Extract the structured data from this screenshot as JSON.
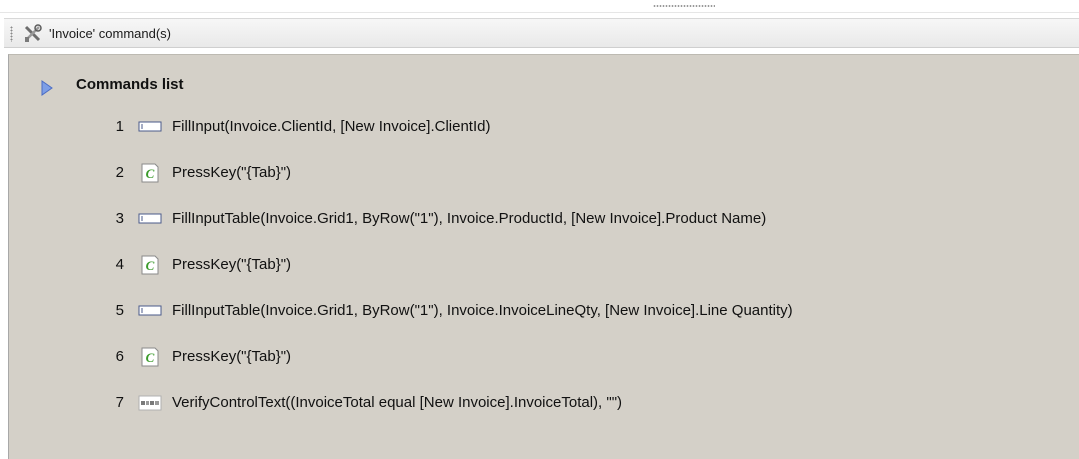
{
  "header": {
    "title": "'Invoice' command(s)",
    "icon": "tools-icon"
  },
  "commands_section": {
    "title": "Commands list",
    "expander_icon": "expand-triangle-icon"
  },
  "commands": [
    {
      "num": "1",
      "icon": "input-field-icon",
      "text": "FillInput(Invoice.ClientId, [New Invoice].ClientId)"
    },
    {
      "num": "2",
      "icon": "script-key-icon",
      "text": "PressKey(\"{Tab}\")"
    },
    {
      "num": "3",
      "icon": "input-field-icon",
      "text": "FillInputTable(Invoice.Grid1, ByRow(\"1\"), Invoice.ProductId, [New Invoice].Product Name)"
    },
    {
      "num": "4",
      "icon": "script-key-icon",
      "text": "PressKey(\"{Tab}\")"
    },
    {
      "num": "5",
      "icon": "input-field-icon",
      "text": "FillInputTable(Invoice.Grid1, ByRow(\"1\"), Invoice.InvoiceLineQty, [New Invoice].Line Quantity)"
    },
    {
      "num": "6",
      "icon": "script-key-icon",
      "text": "PressKey(\"{Tab}\")"
    },
    {
      "num": "7",
      "icon": "verify-text-icon",
      "text": "VerifyControlText((InvoiceTotal equal [New Invoice].InvoiceTotal), \"\")"
    }
  ],
  "colors": {
    "panel_background": "#d4d0c8",
    "expander_blue": "#5b7fd6",
    "script_icon_green": "#3a9a2a"
  }
}
